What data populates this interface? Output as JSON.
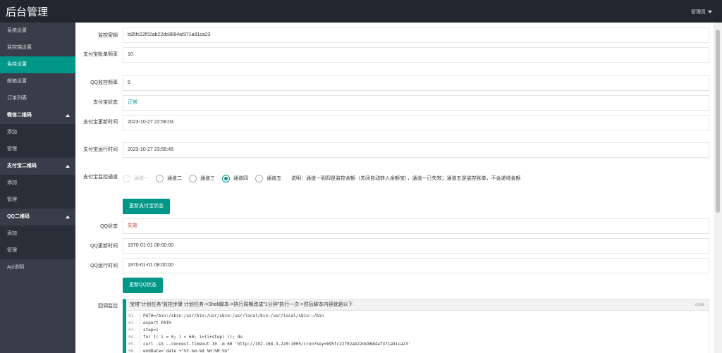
{
  "app": {
    "title": "后台管理",
    "user_label": "管理员"
  },
  "sidebar": {
    "items": [
      {
        "label": "系统设置"
      },
      {
        "label": "监控端设置"
      },
      {
        "label": "免挂设置"
      },
      {
        "label": "邮箱设置"
      },
      {
        "label": "订单列表"
      }
    ],
    "groups": [
      {
        "label": "微信二维码",
        "subs": [
          "添加",
          "管理"
        ]
      },
      {
        "label": "支付宝二维码",
        "subs": [
          "添加",
          "管理"
        ]
      },
      {
        "label": "QQ二维码",
        "subs": [
          "添加",
          "管理"
        ]
      }
    ],
    "api": "Api说明"
  },
  "form": {
    "monitor_key": {
      "label": "监控密钥",
      "value": "b95fc22f02ab22dc8684af371a91ca23"
    },
    "alipay_freq": {
      "label": "支付宝账单频率",
      "value": "10"
    },
    "qq_freq": {
      "label": "QQ监控频率",
      "value": "5"
    },
    "alipay_status": {
      "label": "支付宝状态",
      "value": "正常"
    },
    "alipay_update": {
      "label": "支付宝更新时间",
      "value": "2023-10-27 22:58:03"
    },
    "alipay_run": {
      "label": "支付宝运行时间",
      "value": "2023-10-27 23:58:45"
    },
    "alipay_channel": {
      "label": "支付宝监控通道",
      "options": [
        "通道一",
        "通道二",
        "通道三",
        "通道四",
        "通道五"
      ],
      "selected": "通道四",
      "note": "说明：通道一到四是监控余额（关闭自动转入余额宝），通道一已失效；通道五是监控账单，不会递增金额"
    },
    "update_alipay_btn": "更新支付宝状态",
    "qq_status": {
      "label": "QQ状态",
      "value": "失效"
    },
    "qq_update": {
      "label": "QQ更新时间",
      "value": "1970-01-01 08:00:00"
    },
    "qq_run": {
      "label": "QQ运行时间",
      "value": "1970-01-01 08:00:00"
    },
    "update_qq_btn": "更新QQ状态",
    "callback": {
      "label": "回调监控",
      "title": "宝塔\"计划任务\"监控步骤 计划任务->Shell脚本->执行周期改成\"1分钟\"执行一次->然后脚本内容就是以下",
      "tag": "code",
      "lines": [
        {
          "n": "01.",
          "t": "PATH=/bin:/sbin:/usr/bin:/usr/sbin:/usr/local/bin:/usr/local/sbin:~/bin"
        },
        {
          "n": "02.",
          "t": "export PATH"
        },
        {
          "n": "03.",
          "t": "step=1"
        },
        {
          "n": "04.",
          "t": "for (( i = 0; i < 60; i=(i+step) )); do"
        },
        {
          "n": "05.",
          "t": "curl -sS --connect-timeout 10 -m 60 'http://192.168.3.220:1005/cron?key=b95fc22f02ab22dc8684af371a91ca23'"
        },
        {
          "n": "06.",
          "t": "endDate=`date +\"%Y-%m-%d %H:%M:%S\"`"
        }
      ]
    }
  }
}
